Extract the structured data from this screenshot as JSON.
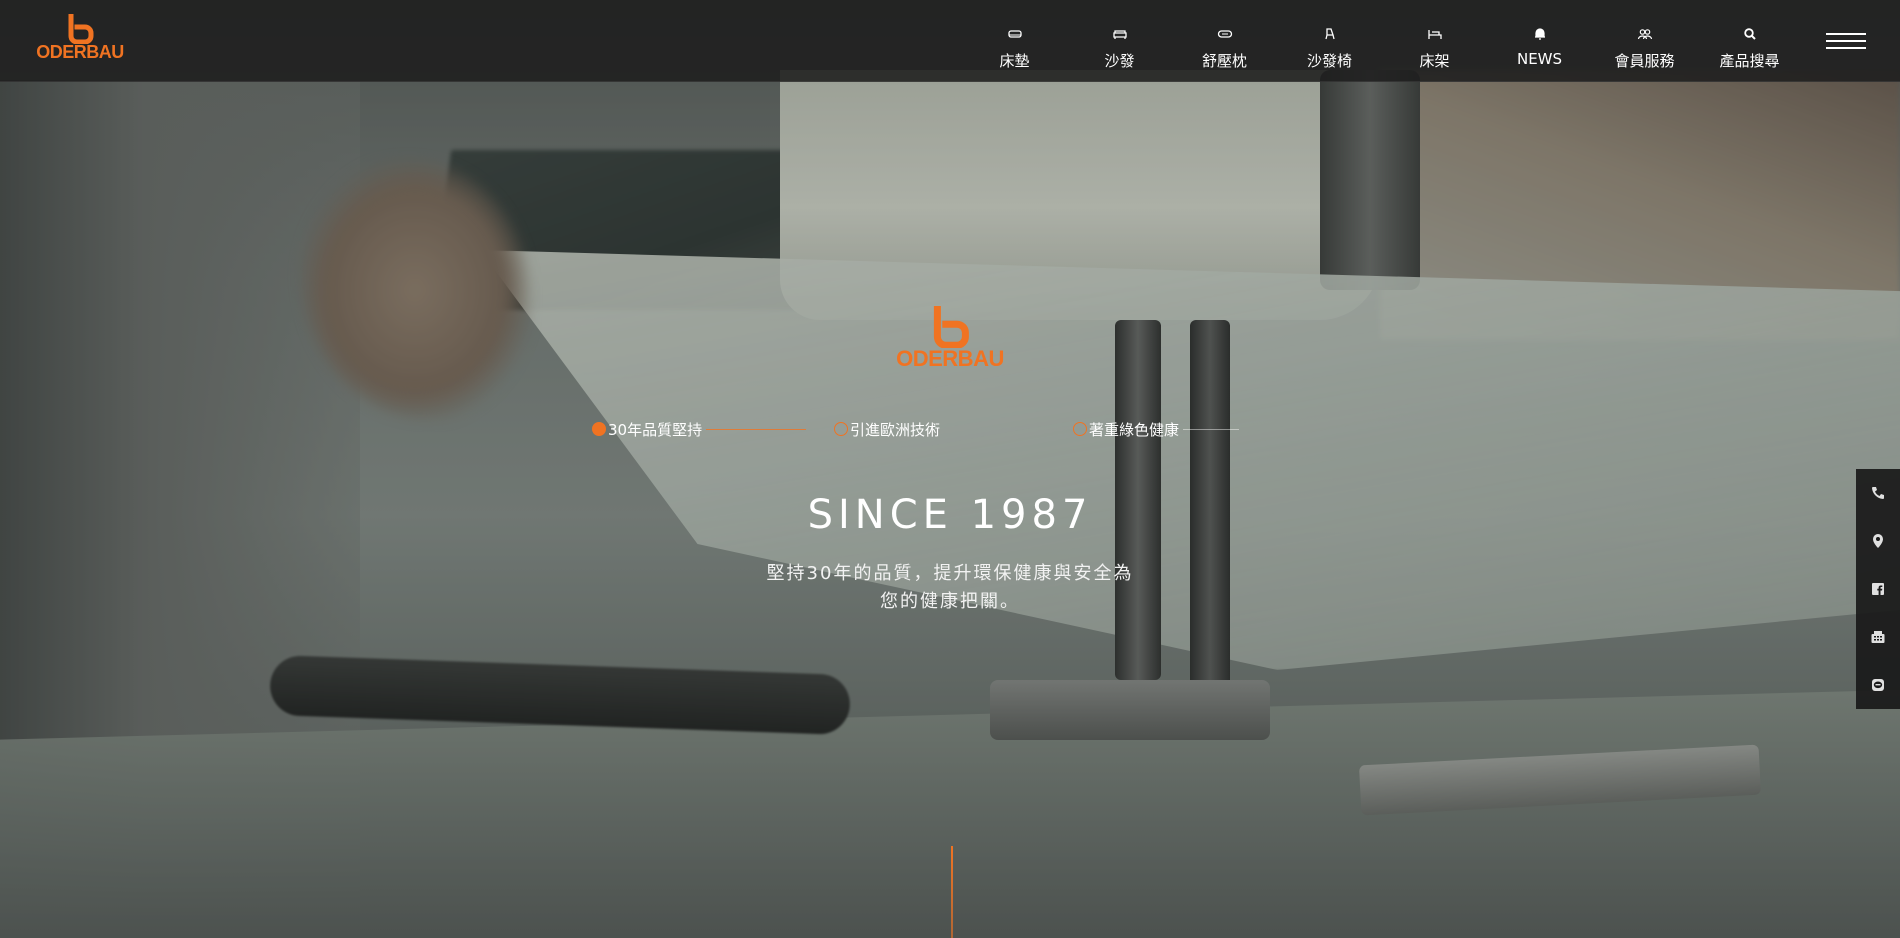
{
  "brand": {
    "name": "ODERBAU",
    "accent": "#f07322"
  },
  "nav": {
    "items": [
      {
        "label": "床墊",
        "icon": "mattress-icon"
      },
      {
        "label": "沙發",
        "icon": "sofa-icon"
      },
      {
        "label": "舒壓枕",
        "icon": "pillow-icon"
      },
      {
        "label": "沙發椅",
        "icon": "armchair-icon"
      },
      {
        "label": "床架",
        "icon": "bed-frame-icon"
      },
      {
        "label": "NEWS",
        "icon": "bell-icon"
      },
      {
        "label": "會員服務",
        "icon": "members-icon"
      },
      {
        "label": "產品搜尋",
        "icon": "search-icon"
      }
    ],
    "menu_icon": "hamburger-menu-icon"
  },
  "hero": {
    "steps": [
      {
        "label": "30年品質堅持",
        "active": true
      },
      {
        "label": "引進歐洲技術",
        "active": false
      },
      {
        "label": "著重綠色健康",
        "active": false
      }
    ],
    "title": "SINCE 1987",
    "description_line1": "堅持30年的品質，提升環保健康與安全為",
    "description_line2": "您的健康把關。"
  },
  "sidebar": {
    "items": [
      {
        "icon": "phone-icon"
      },
      {
        "icon": "location-pin-icon"
      },
      {
        "icon": "facebook-icon"
      },
      {
        "icon": "fax-icon"
      },
      {
        "icon": "line-icon"
      }
    ]
  }
}
